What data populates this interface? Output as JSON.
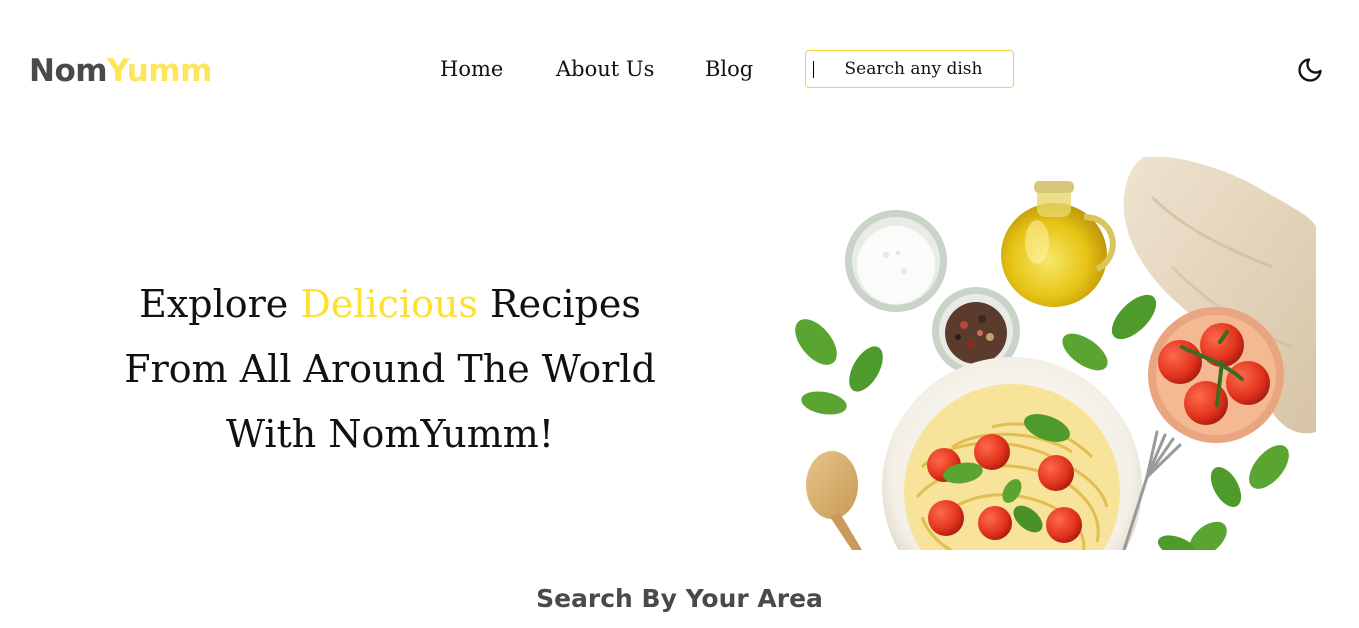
{
  "header": {
    "logo_part_1": "Nom",
    "logo_part_2": "Yumm",
    "nav": {
      "home": "Home",
      "about": "About Us",
      "blog": "Blog"
    },
    "search": {
      "placeholder": "Search any dish",
      "value": ""
    },
    "theme_toggle_icon": "moon-icon"
  },
  "hero": {
    "line1_before": "Explore ",
    "line1_accent": "Delicious",
    "line1_after": " Recipes",
    "line2": "From All Around The World",
    "line3": "With NomYumm!",
    "image_icon": "pasta-dish-illustration"
  },
  "section": {
    "title": "Search By Your Area"
  },
  "colors": {
    "accent": "#fde65a",
    "text_dark": "#111111",
    "logo_gray": "#4a4a4a",
    "search_border": "#f3d23a"
  }
}
